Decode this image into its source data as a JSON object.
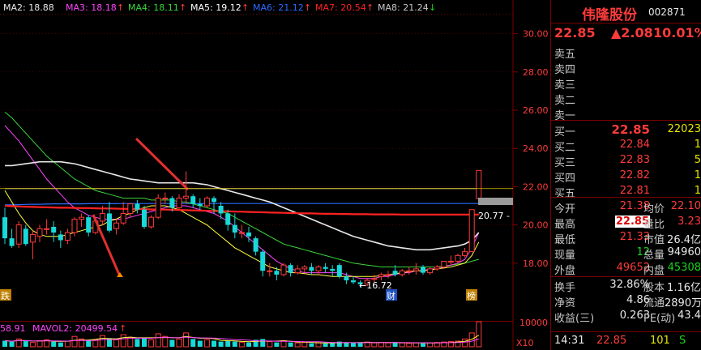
{
  "colors": {
    "bg": "#000000",
    "up": "#ff3b3b",
    "down": "#19d8d8",
    "grid": "#7a0000",
    "ma2": "#e8e8e8",
    "ma3": "#ff44ff",
    "ma4": "#39d639",
    "ma5": "#ffff40",
    "ma6": "#2b6bff",
    "ma7": "#ff2222",
    "ma8": "#c8c8c8"
  },
  "indicators": [
    {
      "label": "MA2: 18.88",
      "color": "#e8e8e8"
    },
    {
      "label": "MA3: 18.18",
      "arrow": "↑",
      "color": "#ff44ff"
    },
    {
      "label": "MA4: 18.11",
      "arrow": "↑",
      "color": "#39d639"
    },
    {
      "label": "MA5: 19.12",
      "arrow": "↑",
      "color": "#ffffff"
    },
    {
      "label": "MA6: 21.12",
      "arrow": "↑",
      "color": "#2b6bff"
    },
    {
      "label": "MA7: 20.54",
      "arrow": "↑",
      "color": "#ff2222"
    },
    {
      "label": "MA8: 21.24",
      "arrow": "↓",
      "color": "#c8c8c8"
    }
  ],
  "y_axis": [
    "30.00",
    "28.00",
    "26.00",
    "24.00",
    "22.00",
    "20.00",
    "18.00"
  ],
  "vol_axis": [
    "10000"
  ],
  "vol_multiplier": "X10",
  "annotations": {
    "low_price": "←16.72",
    "current_level": "20.77",
    "badge_left": "跌",
    "badge_cai": "财",
    "badge_bang": "榜"
  },
  "volume_legend": {
    "left": "58.91",
    "mavol2": "MAVOL2: 20499.54",
    "arrow": "↑"
  },
  "chart_data": {
    "type": "candlestick",
    "series": [
      {
        "o": 20.4,
        "h": 20.9,
        "c": 19.3,
        "l": 19.0
      },
      {
        "o": 19.3,
        "h": 19.8,
        "c": 18.9,
        "l": 18.8
      },
      {
        "o": 19.0,
        "h": 20.2,
        "c": 20.0,
        "l": 18.8
      },
      {
        "o": 19.8,
        "h": 20.0,
        "c": 19.0,
        "l": 18.9
      },
      {
        "o": 19.1,
        "h": 19.7,
        "c": 19.5,
        "l": 18.2
      },
      {
        "o": 19.4,
        "h": 20.0,
        "c": 19.8,
        "l": 19.1
      },
      {
        "o": 19.8,
        "h": 20.3,
        "c": 19.8,
        "l": 19.5
      },
      {
        "o": 19.9,
        "h": 20.2,
        "c": 19.6,
        "l": 19.1
      },
      {
        "o": 19.5,
        "h": 19.7,
        "c": 19.2,
        "l": 18.8
      },
      {
        "o": 19.2,
        "h": 19.8,
        "c": 19.6,
        "l": 19.0
      },
      {
        "o": 19.6,
        "h": 20.4,
        "c": 20.3,
        "l": 19.4
      },
      {
        "o": 20.3,
        "h": 20.6,
        "c": 20.4,
        "l": 19.9
      },
      {
        "o": 20.4,
        "h": 20.5,
        "c": 19.6,
        "l": 19.4
      },
      {
        "o": 19.6,
        "h": 20.2,
        "c": 20.2,
        "l": 19.5
      },
      {
        "o": 20.2,
        "h": 21.0,
        "c": 20.6,
        "l": 20.0
      },
      {
        "o": 20.6,
        "h": 21.2,
        "c": 19.7,
        "l": 19.6
      },
      {
        "o": 19.8,
        "h": 20.3,
        "c": 20.1,
        "l": 19.5
      },
      {
        "o": 20.1,
        "h": 21.2,
        "c": 20.6,
        "l": 20.0
      },
      {
        "o": 20.6,
        "h": 21.1,
        "c": 21.1,
        "l": 20.4
      },
      {
        "o": 21.1,
        "h": 21.3,
        "c": 20.8,
        "l": 20.6
      },
      {
        "o": 20.8,
        "h": 21.0,
        "c": 19.9,
        "l": 19.8
      },
      {
        "o": 19.9,
        "h": 20.5,
        "c": 20.4,
        "l": 19.8
      },
      {
        "o": 20.4,
        "h": 21.6,
        "c": 21.4,
        "l": 20.3
      },
      {
        "o": 21.4,
        "h": 21.7,
        "c": 21.4,
        "l": 21.1
      },
      {
        "o": 21.4,
        "h": 21.5,
        "c": 20.9,
        "l": 20.7
      },
      {
        "o": 20.9,
        "h": 21.6,
        "c": 21.4,
        "l": 20.8
      },
      {
        "o": 21.4,
        "h": 22.8,
        "c": 21.5,
        "l": 21.1
      },
      {
        "o": 21.5,
        "h": 21.6,
        "c": 21.1,
        "l": 20.9
      },
      {
        "o": 21.1,
        "h": 21.4,
        "c": 21.0,
        "l": 20.8
      },
      {
        "o": 21.0,
        "h": 21.5,
        "c": 21.4,
        "l": 20.9
      },
      {
        "o": 21.4,
        "h": 21.5,
        "c": 21.2,
        "l": 20.6
      },
      {
        "o": 21.0,
        "h": 21.2,
        "c": 20.6,
        "l": 20.3
      },
      {
        "o": 20.6,
        "h": 20.8,
        "c": 20.0,
        "l": 19.7
      },
      {
        "o": 20.0,
        "h": 20.6,
        "c": 19.6,
        "l": 19.3
      },
      {
        "o": 19.6,
        "h": 20.0,
        "c": 19.6,
        "l": 19.3
      },
      {
        "o": 19.6,
        "h": 19.9,
        "c": 19.4,
        "l": 19.1
      },
      {
        "o": 19.3,
        "h": 19.4,
        "c": 18.6,
        "l": 18.4
      },
      {
        "o": 18.6,
        "h": 18.7,
        "c": 17.6,
        "l": 17.3
      },
      {
        "o": 17.6,
        "h": 18.0,
        "c": 17.6,
        "l": 17.3
      },
      {
        "o": 17.6,
        "h": 17.8,
        "c": 17.4,
        "l": 17.1
      },
      {
        "o": 17.4,
        "h": 18.0,
        "c": 17.9,
        "l": 17.3
      },
      {
        "o": 17.9,
        "h": 18.0,
        "c": 17.5,
        "l": 17.3
      },
      {
        "o": 17.5,
        "h": 17.9,
        "c": 17.7,
        "l": 17.4
      },
      {
        "o": 17.7,
        "h": 17.9,
        "c": 17.8,
        "l": 17.5
      },
      {
        "o": 17.8,
        "h": 18.0,
        "c": 17.6,
        "l": 17.4
      },
      {
        "o": 17.6,
        "h": 17.9,
        "c": 17.8,
        "l": 17.4
      },
      {
        "o": 17.8,
        "h": 18.0,
        "c": 17.7,
        "l": 17.5
      },
      {
        "o": 17.7,
        "h": 17.9,
        "c": 17.6,
        "l": 17.3
      },
      {
        "o": 17.9,
        "h": 18.0,
        "c": 17.3,
        "l": 17.2
      },
      {
        "o": 17.3,
        "h": 17.5,
        "c": 17.1,
        "l": 16.9
      },
      {
        "o": 17.1,
        "h": 17.3,
        "c": 17.0,
        "l": 16.9
      },
      {
        "o": 17.0,
        "h": 17.1,
        "c": 16.9,
        "l": 16.72
      },
      {
        "o": 16.9,
        "h": 17.2,
        "c": 17.1,
        "l": 16.8
      },
      {
        "o": 17.2,
        "h": 17.4,
        "c": 17.2,
        "l": 17.0
      },
      {
        "o": 17.3,
        "h": 17.5,
        "c": 17.4,
        "l": 17.1
      },
      {
        "o": 17.4,
        "h": 17.6,
        "c": 17.4,
        "l": 17.2
      },
      {
        "o": 17.6,
        "h": 17.9,
        "c": 17.4,
        "l": 17.3
      },
      {
        "o": 17.4,
        "h": 17.7,
        "c": 17.6,
        "l": 17.3
      },
      {
        "o": 17.6,
        "h": 17.8,
        "c": 17.6,
        "l": 17.4
      },
      {
        "o": 17.6,
        "h": 18.0,
        "c": 17.7,
        "l": 17.4
      },
      {
        "o": 17.8,
        "h": 17.9,
        "c": 17.5,
        "l": 17.4
      },
      {
        "o": 17.5,
        "h": 17.8,
        "c": 17.7,
        "l": 17.4
      },
      {
        "o": 17.7,
        "h": 17.9,
        "c": 17.8,
        "l": 17.6
      },
      {
        "o": 17.8,
        "h": 18.1,
        "c": 18.1,
        "l": 17.7
      },
      {
        "o": 18.1,
        "h": 18.4,
        "c": 18.1,
        "l": 17.9
      },
      {
        "o": 18.1,
        "h": 18.5,
        "c": 18.4,
        "l": 18.0
      },
      {
        "o": 18.4,
        "h": 18.8,
        "c": 18.6,
        "l": 18.3
      },
      {
        "o": 18.6,
        "h": 20.8,
        "c": 20.8,
        "l": 18.6
      },
      {
        "o": 21.38,
        "h": 22.85,
        "c": 22.85,
        "l": 21.33
      }
    ],
    "ma": {
      "ma2": [
        23.1,
        23.1,
        23.15,
        23.2,
        23.25,
        23.3,
        23.3,
        23.3,
        23.3,
        23.25,
        23.2,
        23.1,
        23.0,
        22.9,
        22.8,
        22.7,
        22.6,
        22.5,
        22.4,
        22.35,
        22.3,
        22.25,
        22.2,
        22.2,
        22.2,
        22.2,
        22.2,
        22.2,
        22.15,
        22.1,
        22.0,
        21.9,
        21.8,
        21.7,
        21.6,
        21.5,
        21.4,
        21.3,
        21.2,
        21.05,
        20.9,
        20.75,
        20.6,
        20.45,
        20.3,
        20.15,
        20.0,
        19.85,
        19.7,
        19.55,
        19.4,
        19.3,
        19.2,
        19.1,
        19.0,
        18.9,
        18.85,
        18.8,
        18.75,
        18.7,
        18.7,
        18.7,
        18.75,
        18.8,
        18.85,
        18.9,
        19.0,
        19.2,
        19.6
      ],
      "ma3": [
        25.2,
        24.8,
        24.4,
        23.9,
        23.4,
        22.9,
        22.4,
        22.0,
        21.6,
        21.2,
        20.9,
        20.7,
        20.5,
        20.4,
        20.3,
        20.3,
        20.3,
        20.3,
        20.4,
        20.5,
        20.6,
        20.7,
        20.8,
        20.9,
        21.0,
        21.0,
        21.0,
        20.9,
        20.8,
        20.7,
        20.6,
        20.4,
        20.2,
        19.9,
        19.6,
        19.3,
        19.0,
        18.7,
        18.4,
        18.1,
        17.9,
        17.7,
        17.6,
        17.5,
        17.5,
        17.5,
        17.5,
        17.5,
        17.5,
        17.4,
        17.3,
        17.2,
        17.2,
        17.2,
        17.3,
        17.3,
        17.4,
        17.5,
        17.5,
        17.6,
        17.6,
        17.7,
        17.7,
        17.8,
        17.9,
        18.0,
        18.2,
        18.8,
        19.6
      ],
      "ma4": [
        25.9,
        25.6,
        25.2,
        24.8,
        24.4,
        24.0,
        23.6,
        23.3,
        23.0,
        22.7,
        22.4,
        22.2,
        22.0,
        21.8,
        21.7,
        21.6,
        21.5,
        21.4,
        21.4,
        21.4,
        21.4,
        21.3,
        21.3,
        21.3,
        21.3,
        21.2,
        21.2,
        21.1,
        21.0,
        20.9,
        20.8,
        20.7,
        20.6,
        20.4,
        20.2,
        20.0,
        19.8,
        19.6,
        19.4,
        19.2,
        19.0,
        18.9,
        18.8,
        18.7,
        18.6,
        18.5,
        18.4,
        18.3,
        18.2,
        18.1,
        18.0,
        17.95,
        17.9,
        17.85,
        17.8,
        17.8,
        17.8,
        17.8,
        17.8,
        17.8,
        17.8,
        17.8,
        17.8,
        17.85,
        17.9,
        17.95,
        18.0,
        18.1,
        18.2
      ],
      "ma5": [
        21.8,
        21.2,
        20.6,
        20.1,
        19.7,
        19.5,
        19.4,
        19.4,
        19.4,
        19.5,
        19.6,
        19.7,
        19.8,
        19.9,
        20.0,
        20.2,
        20.3,
        20.5,
        20.6,
        20.8,
        20.9,
        21.0,
        21.0,
        21.0,
        20.9,
        20.8,
        20.6,
        20.4,
        20.2,
        20.0,
        19.7,
        19.4,
        19.1,
        18.8,
        18.6,
        18.4,
        18.2,
        18.0,
        17.8,
        17.7,
        17.6,
        17.5,
        17.5,
        17.45,
        17.4,
        17.4,
        17.35,
        17.3,
        17.3,
        17.3,
        17.3,
        17.3,
        17.3,
        17.3,
        17.35,
        17.4,
        17.45,
        17.5,
        17.55,
        17.6,
        17.6,
        17.65,
        17.7,
        17.75,
        17.8,
        17.9,
        18.0,
        18.4,
        19.1
      ],
      "ma6": [
        21.05,
        21.05,
        21.06,
        21.07,
        21.08,
        21.08,
        21.09,
        21.1,
        21.1,
        21.1,
        21.1,
        21.1,
        21.11,
        21.11,
        21.11,
        21.11,
        21.11,
        21.12,
        21.12,
        21.12,
        21.12,
        21.12,
        21.12,
        21.12,
        21.12,
        21.12,
        21.12,
        21.12,
        21.12,
        21.12,
        21.12,
        21.12,
        21.12,
        21.12,
        21.12,
        21.12,
        21.12,
        21.12,
        21.12,
        21.12,
        21.12,
        21.12,
        21.12,
        21.12,
        21.12,
        21.12,
        21.12,
        21.12,
        21.12,
        21.12,
        21.12,
        21.12,
        21.12,
        21.12,
        21.12,
        21.12,
        21.12,
        21.12,
        21.12,
        21.12,
        21.12,
        21.12,
        21.12,
        21.12,
        21.12,
        21.12,
        21.12,
        21.12,
        21.12
      ],
      "ma7": [
        21.0,
        20.98,
        20.96,
        20.95,
        20.94,
        20.93,
        20.92,
        20.91,
        20.9,
        20.9,
        20.89,
        20.88,
        20.88,
        20.87,
        20.86,
        20.86,
        20.85,
        20.84,
        20.84,
        20.83,
        20.82,
        20.81,
        20.8,
        20.8,
        20.79,
        20.78,
        20.77,
        20.76,
        20.75,
        20.74,
        20.73,
        20.72,
        20.71,
        20.7,
        20.69,
        20.68,
        20.67,
        20.66,
        20.65,
        20.64,
        20.63,
        20.62,
        20.61,
        20.6,
        20.6,
        20.59,
        20.58,
        20.58,
        20.57,
        20.57,
        20.56,
        20.56,
        20.56,
        20.55,
        20.55,
        20.55,
        20.55,
        20.54,
        20.54,
        20.54,
        20.54,
        20.54,
        20.54,
        20.54,
        20.54,
        20.54,
        20.54,
        20.54,
        20.54
      ],
      "ma8": [
        21.9,
        21.9,
        21.9,
        21.9,
        21.9,
        21.9,
        21.9,
        21.9,
        21.9,
        21.9,
        21.9,
        21.9,
        21.9,
        21.9,
        21.9,
        21.9,
        21.9,
        21.9,
        21.9,
        21.9,
        21.9,
        21.9,
        21.9,
        21.9,
        21.9,
        21.9,
        21.9,
        21.9,
        21.9,
        21.9,
        21.9,
        21.9,
        21.9,
        21.9,
        21.9,
        21.9,
        21.9,
        21.9,
        21.9,
        21.9,
        21.9,
        21.9,
        21.9,
        21.9,
        21.9,
        21.9,
        21.9,
        21.9,
        21.9,
        21.9,
        21.9,
        21.9,
        21.9,
        21.9,
        21.9,
        21.9,
        21.9,
        21.9,
        21.9,
        21.9,
        21.9,
        21.9,
        21.9,
        21.9,
        21.9,
        21.9,
        21.9,
        21.9,
        21.9
      ]
    },
    "volume": [
      700,
      600,
      900,
      650,
      500,
      700,
      800,
      600,
      500,
      650,
      1200,
      900,
      700,
      800,
      1300,
      1000,
      800,
      1400,
      1100,
      900,
      1000,
      800,
      1500,
      1200,
      800,
      900,
      1600,
      900,
      700,
      800,
      700,
      600,
      700,
      600,
      500,
      500,
      800,
      900,
      600,
      500,
      700,
      500,
      450,
      500,
      400,
      450,
      400,
      450,
      600,
      500,
      450,
      500,
      550,
      450,
      500,
      450,
      500,
      450,
      400,
      450,
      400,
      450,
      500,
      550,
      600,
      650,
      900,
      1600,
      2900
    ],
    "ylim": [
      16.0,
      31.0
    ]
  },
  "quote": {
    "name": "伟隆股份",
    "code": "002871",
    "price": "22.85",
    "change": "▲2.08",
    "change_pct": "10.01%",
    "asks": [
      {
        "label": "卖五",
        "price": "",
        "vol": ""
      },
      {
        "label": "卖四",
        "price": "",
        "vol": ""
      },
      {
        "label": "卖三",
        "price": "",
        "vol": ""
      },
      {
        "label": "卖二",
        "price": "",
        "vol": ""
      },
      {
        "label": "卖一",
        "price": "",
        "vol": ""
      }
    ],
    "bids": [
      {
        "label": "买一",
        "price": "22.85",
        "vol": "22023"
      },
      {
        "label": "买二",
        "price": "22.84",
        "vol": "1"
      },
      {
        "label": "买三",
        "price": "22.83",
        "vol": "5"
      },
      {
        "label": "买四",
        "price": "22.82",
        "vol": "1"
      },
      {
        "label": "买五",
        "price": "22.81",
        "vol": "1"
      }
    ],
    "stats": [
      {
        "l1": "今开",
        "v1": "21.38",
        "c1": "red",
        "l2": "均价",
        "v2": "22.10",
        "c2": "red"
      },
      {
        "l1": "最高",
        "v1": "22.85",
        "c1": "hl",
        "l2": "量比",
        "v2": "3.23",
        "c2": "red"
      },
      {
        "l1": "最低",
        "v1": "21.33",
        "c1": "red",
        "l2": "市值",
        "v2": "26.4亿",
        "c2": "wht"
      },
      {
        "l1": "现量",
        "v1": "12",
        "c1": "grn",
        "l2": "总量",
        "v2": "94960",
        "c2": "wht"
      },
      {
        "l1": "外盘",
        "v1": "49652",
        "c1": "red",
        "l2": "内盘",
        "v2": "45308",
        "c2": "grn"
      }
    ],
    "stats2": [
      {
        "l1": "换手",
        "v1": "32.86%",
        "c1": "wht",
        "l2": "股本",
        "v2": "1.16亿",
        "c2": "wht"
      },
      {
        "l1": "净资",
        "v1": "4.86",
        "c1": "wht",
        "l2": "流通",
        "v2": "2890万",
        "c2": "wht"
      },
      {
        "l1": "收益(三)",
        "v1": "0.263",
        "c1": "wht",
        "l2": "PE(动)",
        "v2": "43.4",
        "c2": "wht"
      }
    ],
    "tick": {
      "time": "14:31",
      "price": "22.85",
      "vol": "101",
      "side": "S"
    }
  }
}
